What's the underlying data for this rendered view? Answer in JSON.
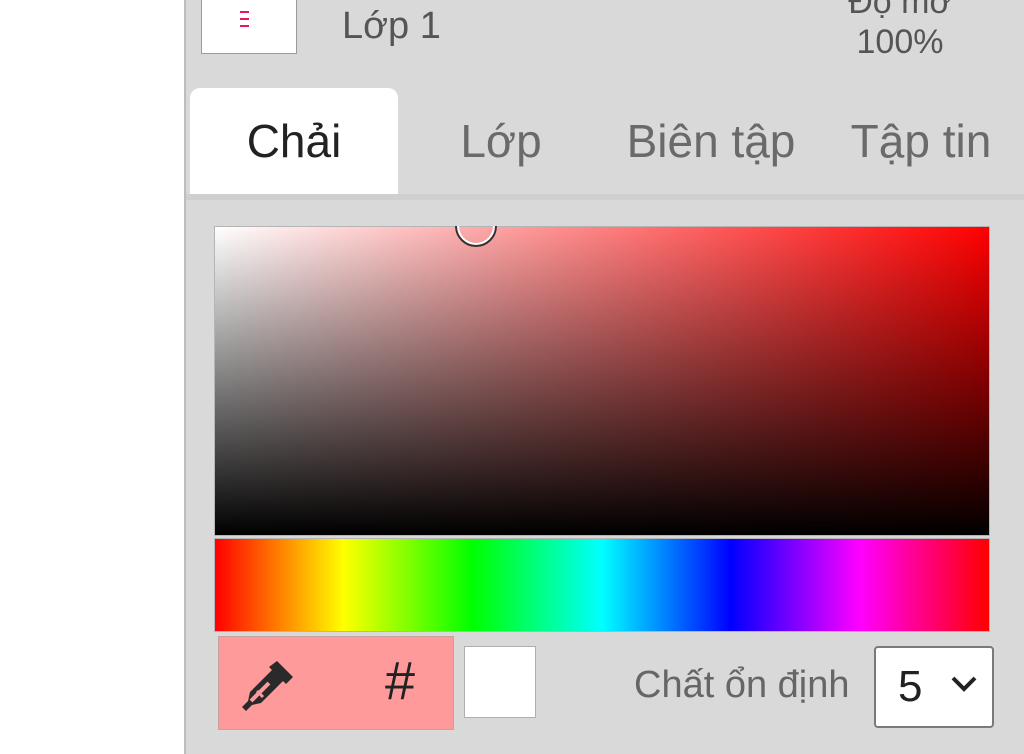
{
  "layer": {
    "name": "Lớp 1",
    "opacity_label": "Độ mờ",
    "opacity_value": "100%"
  },
  "tabs": [
    {
      "label": "Chải",
      "active": true
    },
    {
      "label": "Lớp",
      "active": false
    },
    {
      "label": "Biên tập",
      "active": false
    },
    {
      "label": "Tập tin",
      "active": false
    }
  ],
  "color_picker": {
    "hue_color": "#ff0000",
    "selected_color": "#ff9a9a",
    "secondary_color": "#ffffff",
    "hex_button_label": "#",
    "eyedropper_icon": "eyedropper-icon"
  },
  "stabilizer": {
    "label": "Chất ổn định",
    "value": "5"
  },
  "colors": {
    "panel_bg": "#d9d9d9",
    "active_tab_bg": "#ffffff",
    "layer_mark": "#e8195a"
  }
}
